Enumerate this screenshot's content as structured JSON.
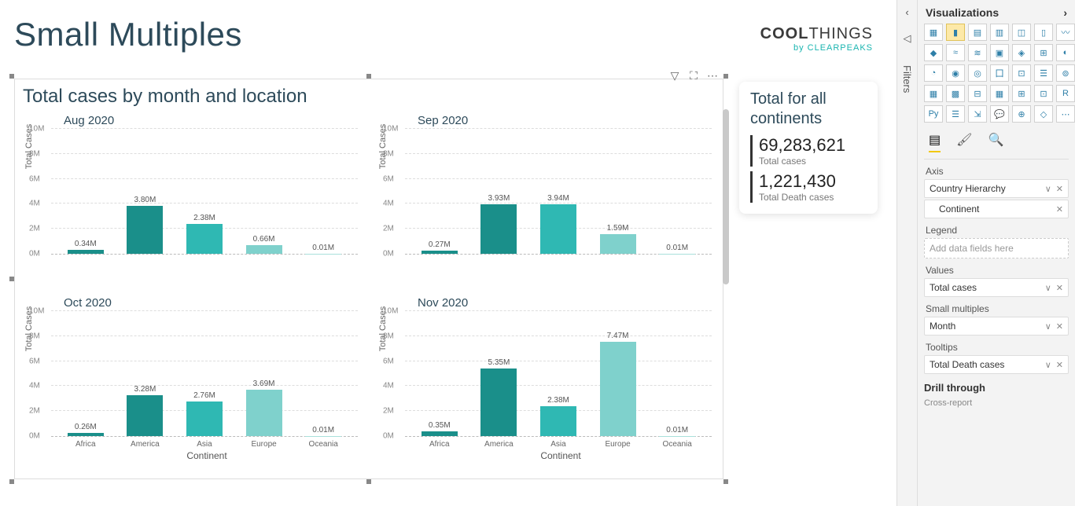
{
  "page_title": "Small Multiples",
  "brand": {
    "top1": "COOL",
    "top2": "THINGS",
    "bottom": "by CLEARPEAKS"
  },
  "visual_actions": {
    "filter": "filter-icon",
    "focus": "focus-mode-icon",
    "more": "more-icon"
  },
  "chart": {
    "title": "Total cases by month and location",
    "ylabel": "Total Cases",
    "xlabel": "Continent",
    "yticks": [
      "0M",
      "2M",
      "4M",
      "6M",
      "8M",
      "10M"
    ],
    "categories": [
      "Africa",
      "America",
      "Asia",
      "Europe",
      "Oceania"
    ]
  },
  "chart_data": {
    "type": "bar",
    "title": "Total cases by month and location",
    "xlabel": "Continent",
    "ylabel": "Total Cases",
    "ylim": [
      0,
      10
    ],
    "y_unit": "M",
    "categories": [
      "Africa",
      "America",
      "Asia",
      "Europe",
      "Oceania"
    ],
    "small_multiples_field": "Month",
    "panels": [
      {
        "name": "Aug 2020",
        "values": [
          0.34,
          3.8,
          2.38,
          0.66,
          0.01
        ],
        "labels": [
          "0.34M",
          "3.80M",
          "2.38M",
          "0.66M",
          "0.01M"
        ]
      },
      {
        "name": "Sep 2020",
        "values": [
          0.27,
          3.93,
          3.94,
          1.59,
          0.01
        ],
        "labels": [
          "0.27M",
          "3.93M",
          "3.94M",
          "1.59M",
          "0.01M"
        ]
      },
      {
        "name": "Oct 2020",
        "values": [
          0.26,
          3.28,
          2.76,
          3.69,
          0.01
        ],
        "labels": [
          "0.26M",
          "3.28M",
          "2.76M",
          "3.69M",
          "0.01M"
        ]
      },
      {
        "name": "Nov 2020",
        "values": [
          0.35,
          5.35,
          2.38,
          7.47,
          0.01
        ],
        "labels": [
          "0.35M",
          "5.35M",
          "2.38M",
          "7.47M",
          "0.01M"
        ]
      }
    ],
    "colors": [
      "#1a8f8a",
      "#1a8f8a",
      "#2fb8b3",
      "#7fd1cc",
      "#a9e0dc"
    ]
  },
  "card": {
    "title": "Total for all continents",
    "metrics": [
      {
        "value": "69,283,621",
        "label": "Total cases"
      },
      {
        "value": "1,221,430",
        "label": "Total Death cases"
      }
    ]
  },
  "filters_label": "Filters",
  "viz_pane": {
    "title": "Visualizations",
    "tabs": {
      "fields": "fields-tab",
      "format": "format-tab",
      "analytics": "analytics-tab"
    },
    "sections": {
      "axis_label": "Axis",
      "axis_field": "Country Hierarchy",
      "axis_sub": "Continent",
      "legend_label": "Legend",
      "legend_placeholder": "Add data fields here",
      "values_label": "Values",
      "values_field": "Total cases",
      "sm_label": "Small multiples",
      "sm_field": "Month",
      "tooltips_label": "Tooltips",
      "tooltips_field": "Total Death cases",
      "drill_label": "Drill through",
      "cross_label": "Cross-report"
    }
  }
}
